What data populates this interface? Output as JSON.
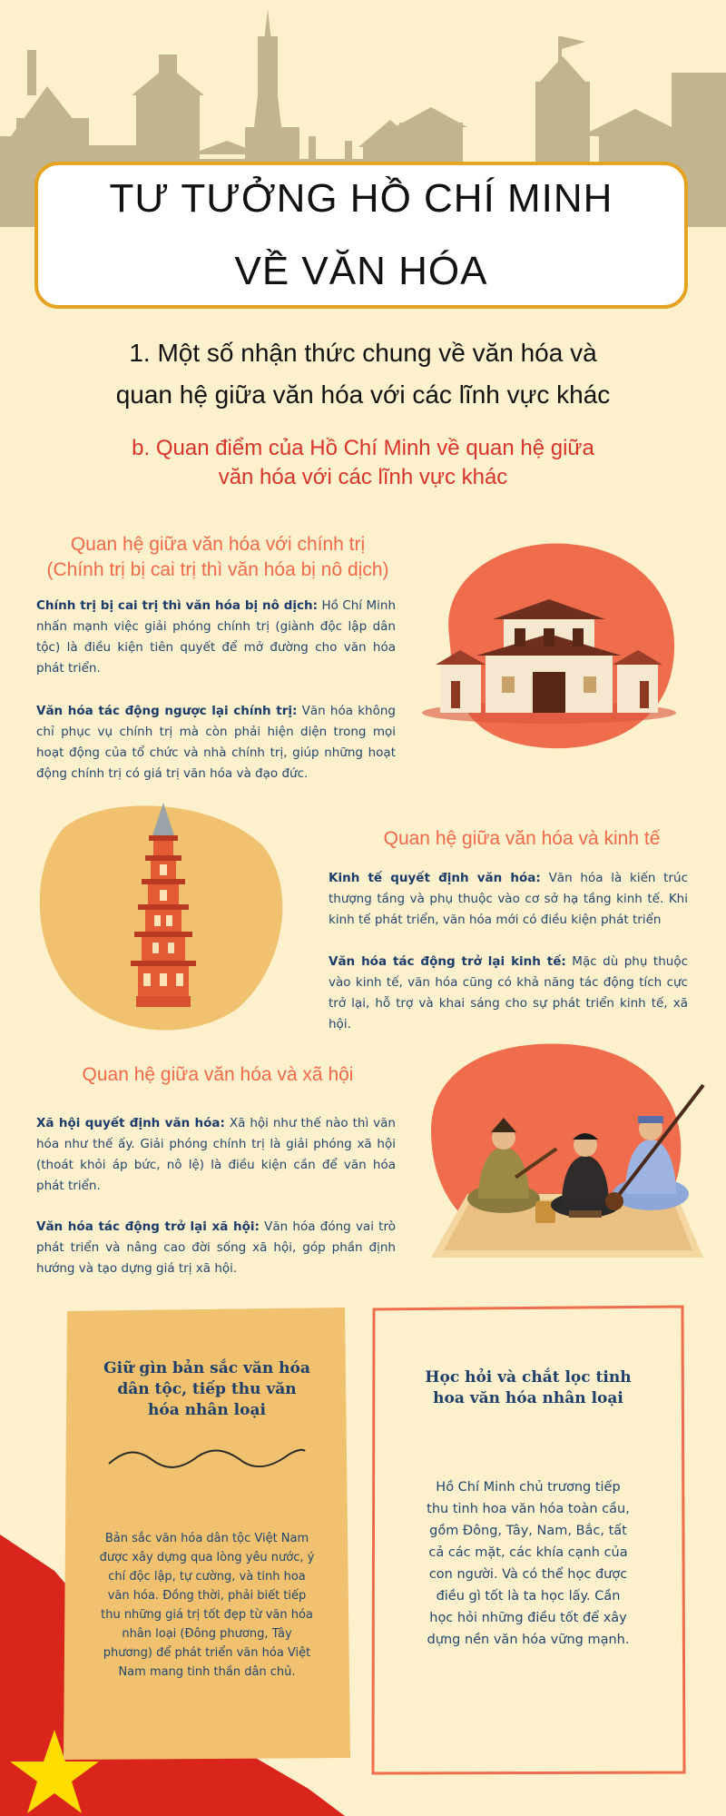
{
  "header": {
    "title_line1": "TƯ TƯỞNG HỒ CHÍ MINH",
    "title_line2": "VỀ VĂN HÓA"
  },
  "section": {
    "title_line1": "1. Một số nhận thức chung về văn hóa và",
    "title_line2": "quan hệ giữa văn hóa với các lĩnh vực khác",
    "subtitle_line1": "b. Quan điểm của Hồ Chí Minh về quan hệ giữa",
    "subtitle_line2": "văn hóa với các lĩnh vực khác"
  },
  "politics": {
    "heading_line1": "Quan hệ giữa văn hóa với chính trị",
    "heading_line2": "(Chính trị bị cai trị thì văn hóa bị nô dịch)",
    "p1_bold": "Chính trị bị cai trị thì văn hóa bị nô dịch:",
    "p1_text": " Hồ Chí Minh nhấn mạnh việc giải phóng chính trị (giành độc lập dân tộc) là điều kiện tiên quyết để mở đường cho văn hóa phát triển.",
    "p2_bold": "Văn hóa tác động ngược lại chính trị:",
    "p2_text": " Văn hóa không chỉ phục vụ chính trị mà còn phải hiện diện trong mọi hoạt động của tổ chức và nhà chính trị, giúp những hoạt động chính trị có giá trị văn hóa và đạo đức."
  },
  "economy": {
    "heading": "Quan hệ giữa văn hóa và kinh tế",
    "p1_bold": "Kinh tế quyết định văn hóa:",
    "p1_text": " Văn hóa là kiến trúc thượng tầng và phụ thuộc vào cơ sở hạ tầng kinh tế. Khi kinh tế phát triển, văn hóa mới có điều kiện phát triển",
    "p2_bold": "Văn hóa tác động trở lại kinh tế:",
    "p2_text": " Mặc dù phụ thuộc vào kinh tế, văn hóa cũng có khả năng tác động tích cực trở lại, hỗ trợ và khai sáng cho sự phát triển kinh tế, xã hội."
  },
  "society": {
    "heading": "Quan hệ giữa văn hóa và xã hội",
    "p1_bold": "Xã hội quyết định văn hóa:",
    "p1_text": " Xã hội như thế nào thì văn hóa như thế ấy. Giải phóng chính trị là giải phóng xã hội (thoát khỏi áp bức, nô lệ) là điều kiện cần để văn hóa phát triển.",
    "p2_bold": "Văn hóa tác động trở lại xã hội:",
    "p2_text": " Văn hóa đóng vai trò phát triển và nâng cao đời sống xã hội, góp phần định hướng và tạo dựng giá trị xã hội."
  },
  "card_left": {
    "title_line1": "Giữ gìn bản sắc văn hóa",
    "title_line2": "dân tộc, tiếp thu văn",
    "title_line3": "hóa nhân loại",
    "text": "Bản sắc văn hóa dân tộc Việt Nam được xây dựng qua lòng yêu nước, ý chí độc lập, tự cường, và tinh hoa văn hóa. Đồng thời, phải biết tiếp thu những giá trị tốt đẹp từ văn hóa nhân loại (Đông phương, Tây phương) để phát triển văn hóa Việt Nam mang tinh thần dân chủ."
  },
  "card_right": {
    "title_line1": "Học hỏi và chắt lọc tinh",
    "title_line2": "hoa văn hóa nhân loại",
    "text": "Hồ Chí Minh chủ trương tiếp thu tinh hoa văn hóa toàn cầu, gồm Đông, Tây, Nam, Bắc, tất cả các mặt, các khía cạnh của con người. Và có thể học được điều gì tốt là ta học lấy. Cần học hỏi những điều tốt để xây dựng nền văn hóa vững mạnh."
  },
  "colors": {
    "background": "#fdf0cc",
    "accent_orange": "#ef6d4c",
    "heading_red": "#d8342a",
    "text_navy": "#23466e",
    "yellow": "#f0c16e",
    "flag_red": "#da251d",
    "star_yellow": "#ffdd00"
  },
  "icons": [
    "temple-illustration",
    "pagoda-illustration",
    "musicians-illustration",
    "vietnam-flag-icon",
    "wavy-divider-icon"
  ]
}
